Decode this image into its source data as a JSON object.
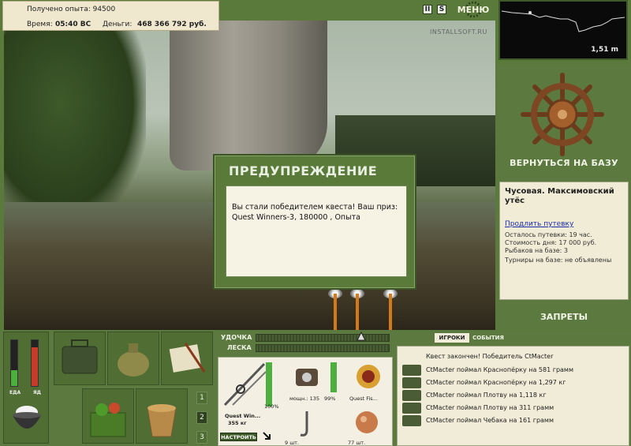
{
  "stats": {
    "xp_label": "Получено опыта: 94500",
    "time_label": "Время:",
    "time_value": "05:40 ВС",
    "money_label": "Деньги:",
    "money_value": "468 366 792 руб."
  },
  "top_buttons": {
    "pause": "II",
    "sound": "S",
    "menu": "МЕНЮ"
  },
  "watermark": "INSTALLSOFT.RU",
  "depth": {
    "value": "1,51 m"
  },
  "right_panel": {
    "return_label": "ВЕРНУТЬСЯ НА БАЗУ",
    "location_title": "Чусовая. Максимовский утёс",
    "extend_link": "Продлить путевку",
    "remaining": "Осталось путевки: 19 час.",
    "day_cost": "Стоимость дня: 17 000 руб.",
    "anglers": "Рыбаков на базе: 3",
    "tournaments": "Турниры на базе: не объявлены",
    "bans_label": "ЗАПРЕТЫ"
  },
  "dialog": {
    "title": "ПРЕДУПРЕЖДЕНИЕ",
    "message": "Вы стали победителем квеста! Ваш приз: Quest Winners-3, 180000 , Опыта"
  },
  "needs": {
    "food": "ЕДА",
    "poison": "ЯД",
    "food_level": 0.35,
    "poison_level": 0.85
  },
  "inventory_pages": [
    "1",
    "2",
    "3"
  ],
  "rod_controls": {
    "rod_label": "УДОЧКА",
    "line_label": "ЛЕСКА"
  },
  "tackle": {
    "rod_name": "Quest Win...",
    "rod_weight": "355 кг",
    "rod_condition": "100%",
    "reel_power": "мощн.: 135",
    "reel_condition": "99%",
    "line_name": "Quest Fis...",
    "hooks_count": "9 шт.",
    "bait_count": "77 шт.",
    "setup_label": "НАСТРОИТЬ"
  },
  "chat": {
    "tab_players": "ИГРОКИ",
    "tab_events": "СОБЫТИЯ",
    "first_line": "Квест закончен! Победитель CtMacter",
    "rows": [
      "CtMacter поймал Краснопёрку на 581 грамм",
      "CtMacter поймал Краснопёрку на 1,297 кг",
      "CtMacter поймал Плотву на 1,118 кг",
      "CtMacter поймал Плотву на 311 грамм",
      "CtMacter поймал Чебака на 161 грамм"
    ]
  }
}
